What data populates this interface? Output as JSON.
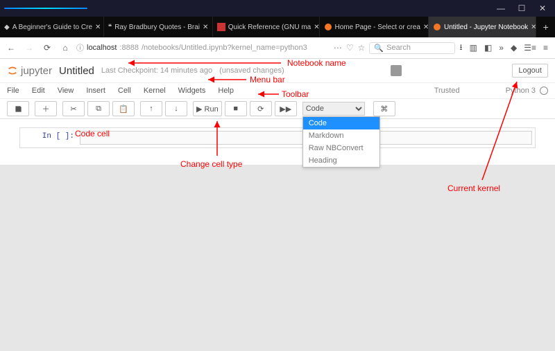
{
  "browser": {
    "tabs": [
      {
        "favicon": "diamond",
        "label": "A Beginner's Guide to Cre"
      },
      {
        "favicon": "brainy",
        "label": "Ray Bradbury Quotes - Brai"
      },
      {
        "favicon": "gnu",
        "label": "Quick Reference (GNU ma"
      },
      {
        "favicon": "jup",
        "label": "Home Page - Select or crea"
      },
      {
        "favicon": "jup",
        "label": "Untitled - Jupyter Notebook"
      }
    ],
    "url_host": "localhost",
    "url_port": ":8888",
    "url_path": "/notebooks/Untitled.ipynb?kernel_name=python3",
    "search_placeholder": "Search"
  },
  "jupyter": {
    "logo_text": "jupyter",
    "title": "Untitled",
    "checkpoint": "Last Checkpoint: 14 minutes ago",
    "unsaved": "(unsaved changes)",
    "logout": "Logout",
    "menus": [
      "File",
      "Edit",
      "View",
      "Insert",
      "Cell",
      "Kernel",
      "Widgets",
      "Help"
    ],
    "trusted": "Trusted",
    "kernel": "Python 3",
    "run_label": "▶ Run",
    "celltype_selected": "Code",
    "celltype_options": [
      "Code",
      "Markdown",
      "Raw NBConvert",
      "Heading"
    ],
    "prompt": "In [ ]:"
  },
  "annotations": {
    "notebook_name": "Notebook name",
    "menu_bar": "Menu bar",
    "toolbar": "Toolbar",
    "code_cell": "Code cell",
    "change_cell_type": "Change cell type",
    "current_kernel": "Current kernel"
  }
}
